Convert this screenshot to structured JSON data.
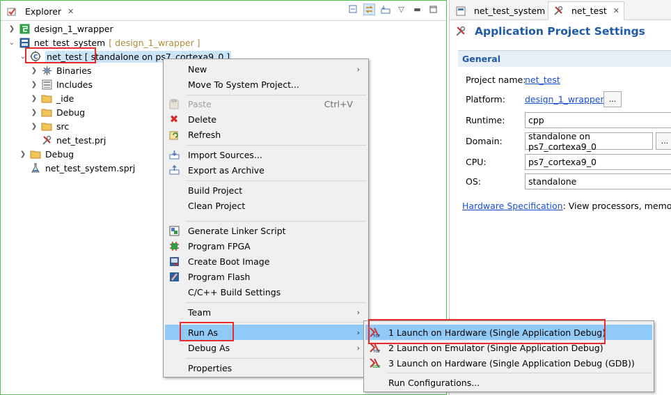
{
  "explorer": {
    "tab_label": "Explorer",
    "tree": [
      {
        "label": "design_1_wrapper",
        "suffix": ""
      },
      {
        "label": "net_test_system",
        "suffix": "[ design_1_wrapper ]"
      },
      {
        "label": "net_test [ standalone on ps7_cortexa9_0 ]",
        "suffix": ""
      },
      {
        "label": "Binaries",
        "suffix": ""
      },
      {
        "label": "Includes",
        "suffix": ""
      },
      {
        "label": "_ide",
        "suffix": ""
      },
      {
        "label": "Debug",
        "suffix": ""
      },
      {
        "label": "src",
        "suffix": ""
      },
      {
        "label": "net_test.prj",
        "suffix": ""
      },
      {
        "label": "Debug",
        "suffix": ""
      },
      {
        "label": "net_test_system.sprj",
        "suffix": ""
      }
    ]
  },
  "editor": {
    "tabs": [
      "net_test_system",
      "net_test"
    ],
    "title": "Application Project Settings",
    "section": "General",
    "fields": {
      "project_name_label": "Project name:",
      "project_name_value": "net_test",
      "platform_label": "Platform:",
      "platform_value": "design_1_wrapper",
      "runtime_label": "Runtime:",
      "runtime_value": "cpp",
      "domain_label": "Domain:",
      "domain_value": "standalone on ps7_cortexa9_0",
      "cpu_label": "CPU:",
      "cpu_value": "ps7_cortexa9_0",
      "os_label": "OS:",
      "os_value": "standalone",
      "browse_label": "..."
    },
    "hw_link": "Hardware Specification",
    "hw_text": ": View processors, memory r"
  },
  "context_menu": {
    "items": [
      {
        "label": "New",
        "accel": "",
        "arrow": "›"
      },
      {
        "label": "Move To System Project...",
        "accel": "",
        "arrow": ""
      },
      {
        "label": "Paste",
        "accel": "Ctrl+V",
        "arrow": ""
      },
      {
        "label": "Delete",
        "accel": "",
        "arrow": ""
      },
      {
        "label": "Refresh",
        "accel": "",
        "arrow": ""
      },
      {
        "label": "Import Sources...",
        "accel": "",
        "arrow": ""
      },
      {
        "label": "Export as Archive",
        "accel": "",
        "arrow": ""
      },
      {
        "label": "Build Project",
        "accel": "",
        "arrow": ""
      },
      {
        "label": "Clean Project",
        "accel": "",
        "arrow": ""
      },
      {
        "label": "Generate Linker Script",
        "accel": "",
        "arrow": ""
      },
      {
        "label": "Program FPGA",
        "accel": "",
        "arrow": ""
      },
      {
        "label": "Create Boot Image",
        "accel": "",
        "arrow": ""
      },
      {
        "label": "Program Flash",
        "accel": "",
        "arrow": ""
      },
      {
        "label": "C/C++ Build Settings",
        "accel": "",
        "arrow": ""
      },
      {
        "label": "Team",
        "accel": "",
        "arrow": "›"
      },
      {
        "label": "Run As",
        "accel": "",
        "arrow": "›"
      },
      {
        "label": "Debug As",
        "accel": "",
        "arrow": "›"
      },
      {
        "label": "Properties",
        "accel": "",
        "arrow": ""
      }
    ]
  },
  "run_as_menu": {
    "items": [
      {
        "label": "1 Launch on Hardware (Single Application Debug)"
      },
      {
        "label": "2 Launch on Emulator (Single Application Debug)"
      },
      {
        "label": "3 Launch on Hardware (Single Application Debug (GDB))"
      },
      {
        "label": "Run Configurations..."
      }
    ]
  },
  "colors": {
    "accent_blue": "#1e5aa8",
    "highlight": "#91c9f7",
    "annotation_red": "#e52b2b",
    "link": "#1a4fd1"
  }
}
